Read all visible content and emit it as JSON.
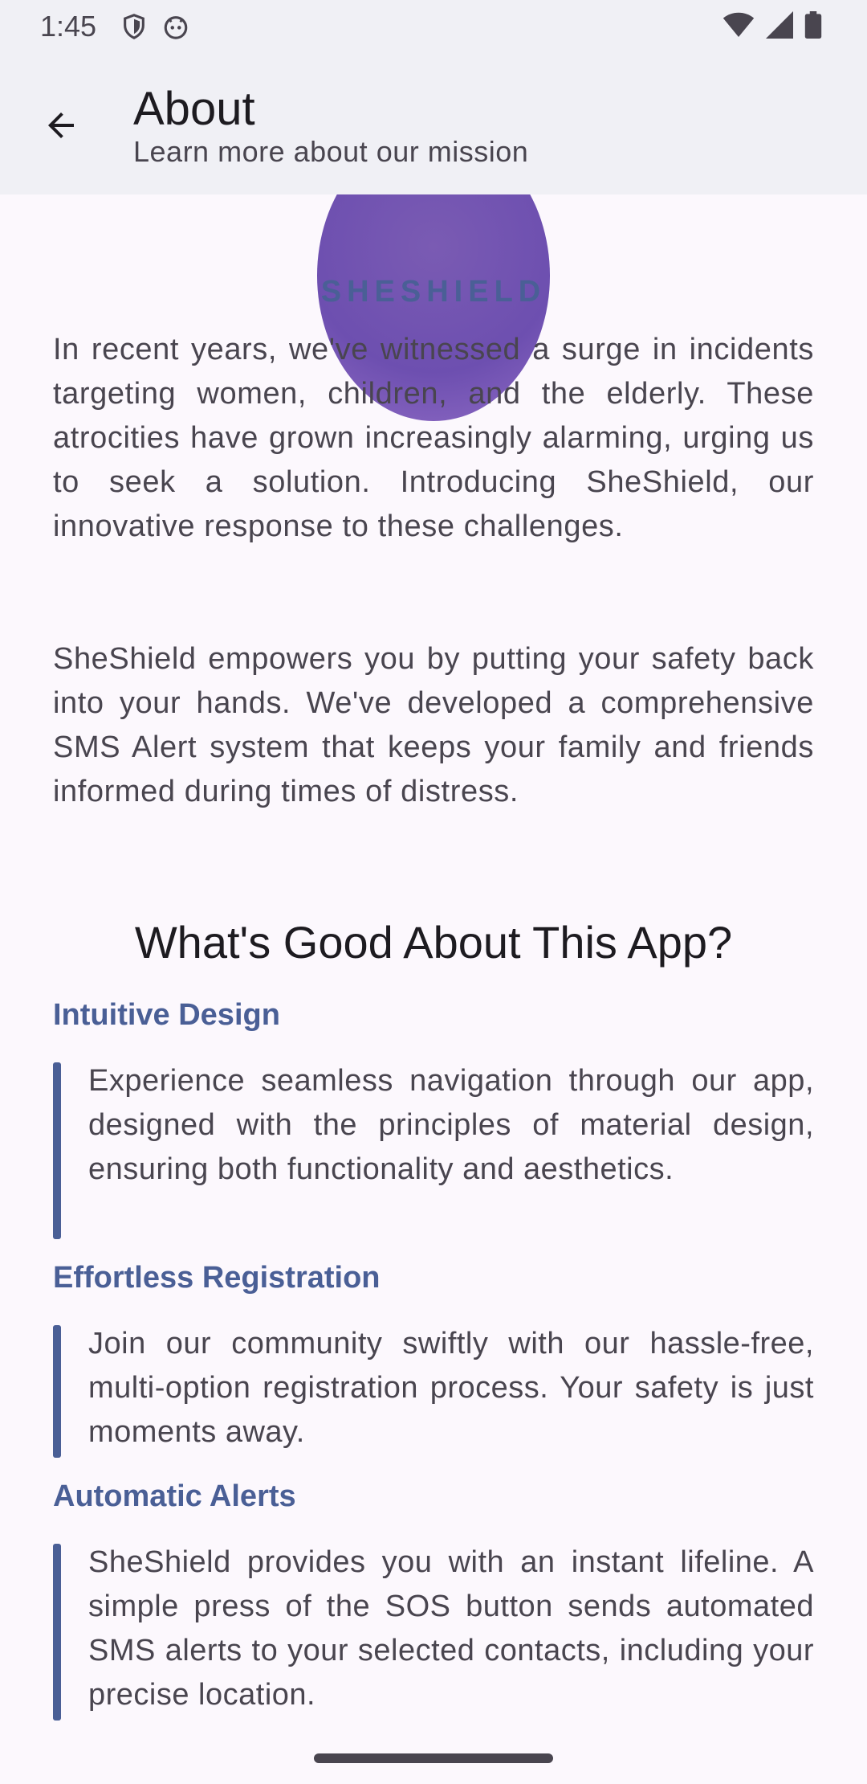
{
  "status": {
    "time": "1:45",
    "icons_left": [
      "shield-icon",
      "android-icon"
    ],
    "icons_right": [
      "wifi-icon",
      "signal-icon",
      "battery-icon"
    ]
  },
  "app_bar": {
    "title": "About",
    "subtitle": "Learn more about our mission",
    "back_icon": "arrow-back-icon"
  },
  "brand": "SHESHIELD",
  "paragraphs": [
    "In recent years, we've witnessed a surge in incidents targeting women, children, and the elderly. These atrocities have grown increasingly alarming, urging us to seek a solution. Introducing SheShield, our innovative response to these challenges.",
    "SheShield empowers you by putting your safety back into your hands. We've developed a comprehensive SMS Alert system that keeps your family and friends informed during times of distress."
  ],
  "good_title": "What's Good About This App?",
  "features": [
    {
      "title": "Intuitive Design",
      "text": "Experience seamless navigation through our app, designed with the principles of material design, ensuring both functionality and aesthetics."
    },
    {
      "title": "Effortless Registration",
      "text": "Join our community swiftly with our hassle-free, multi-option registration process. Your safety is just moments away."
    },
    {
      "title": "Automatic Alerts",
      "text": "SheShield provides you with an instant lifeline. A simple press of the SOS button sends automated SMS alerts to your selected contacts, including your precise location."
    }
  ],
  "colors": {
    "accent": "#4a5f96",
    "hero": "#7a5bb3",
    "background": "#fcf8fd",
    "app_bar": "#f0f0f5"
  }
}
